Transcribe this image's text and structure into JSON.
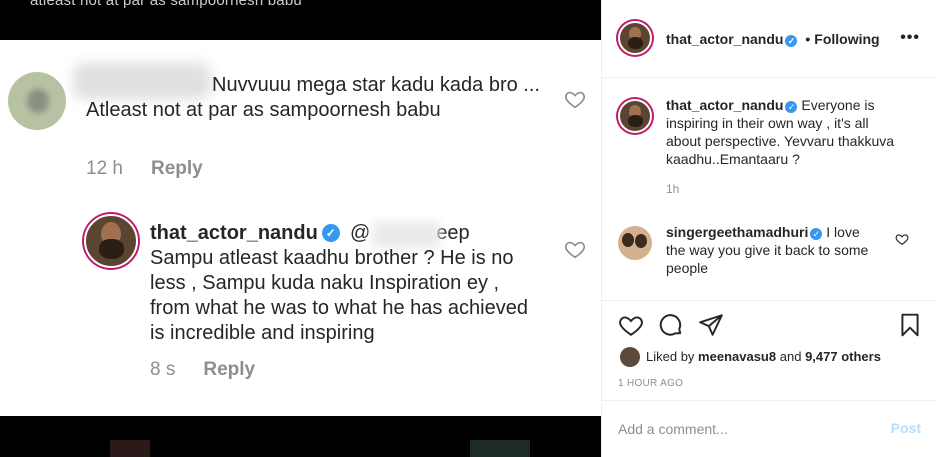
{
  "image": {
    "top_cut_text": "atleast not at par as sampoornesh babu",
    "comment1": {
      "text_line1": "Nuvvuuu mega star kadu kada bro ...",
      "text_line2": "Atleast not at par as sampoornesh babu",
      "time": "12 h",
      "reply": "Reply"
    },
    "comment2": {
      "username": "that_actor_nandu",
      "mention_start": "@",
      "mention_end": "eep",
      "text": "Sampu atleast kaadhu brother ? He is no less , Sampu kuda naku Inspiration ey , from what he was to what he has achieved is incredible and inspiring",
      "time": "8 s",
      "reply": "Reply"
    }
  },
  "header": {
    "username": "that_actor_nandu",
    "separator": "•",
    "follow_state": "Following",
    "more_glyph": "•••"
  },
  "comments": [
    {
      "username": "that_actor_nandu",
      "text": "Everyone is inspiring in their own way , it's all about perspective. Yevvaru thakkuva kaadhu..Emantaaru ?",
      "time": "1h"
    },
    {
      "username": "singergeethamadhuri",
      "text": "I love the way you give it back to some people"
    }
  ],
  "likes": {
    "prefix": "Liked by",
    "user": "meenavasu8",
    "middle": "and",
    "count": "9,477 others"
  },
  "post_date": "1 HOUR AGO",
  "add_comment": {
    "placeholder": "Add a comment...",
    "post_label": "Post"
  },
  "colors": {
    "verified": "#3897f0",
    "story_ring": "#c0196e",
    "post_disabled": "#b2dffc",
    "muted": "#8e8e8e"
  }
}
